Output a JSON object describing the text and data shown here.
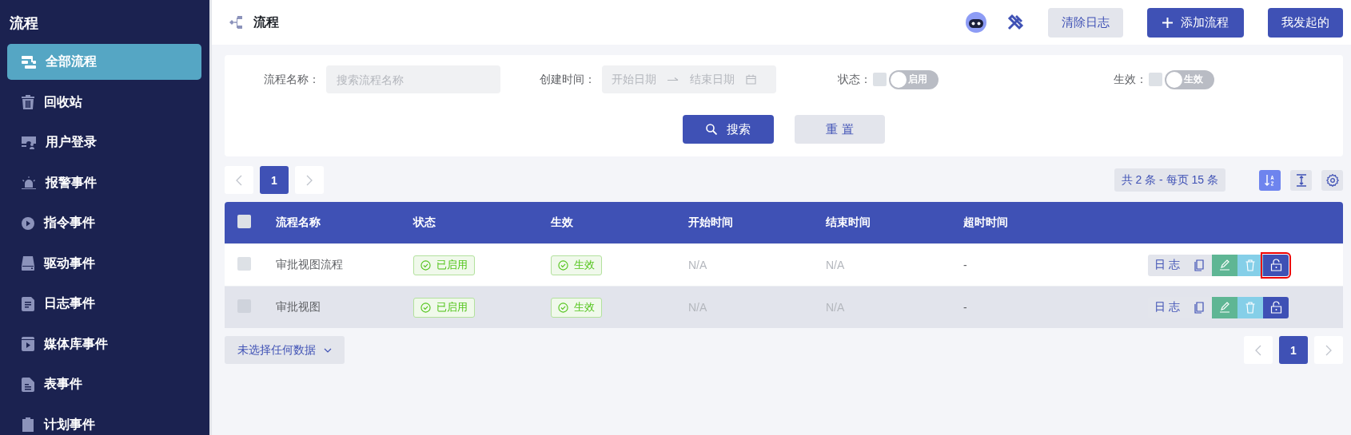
{
  "sidebar": {
    "title": "流程",
    "items": [
      {
        "label": "全部流程",
        "selected": true
      },
      {
        "label": "回收站",
        "selected": false
      },
      {
        "label": "用户登录",
        "selected": false
      },
      {
        "label": "报警事件",
        "selected": false
      },
      {
        "label": "指令事件",
        "selected": false
      },
      {
        "label": "驱动事件",
        "selected": false
      },
      {
        "label": "日志事件",
        "selected": false
      },
      {
        "label": "媒体库事件",
        "selected": false
      },
      {
        "label": "表事件",
        "selected": false
      },
      {
        "label": "计划事件",
        "selected": false
      }
    ]
  },
  "header": {
    "title": "流程",
    "buttons": [
      {
        "label": "清除日志",
        "kind": "secondary"
      },
      {
        "label": "添加流程",
        "kind": "add"
      },
      {
        "label": "我发起的",
        "kind": "primary"
      }
    ]
  },
  "filters": {
    "name": {
      "label": "流程名称：",
      "placeholder": "搜索流程名称"
    },
    "created": {
      "label": "创建时间：",
      "start_placeholder": "开始日期",
      "end_placeholder": "结束日期"
    },
    "switches": [
      {
        "label": "状态：",
        "checked": false,
        "switch_label": "启用",
        "on": false
      },
      {
        "label": "生效：",
        "checked": false,
        "switch_label": "生效",
        "on": false
      }
    ],
    "search_button": "搜索",
    "reset_button": "重 置"
  },
  "top_pager": {
    "pages": [
      {
        "label": "1",
        "selected": true
      }
    ]
  },
  "summary": "共 2 条 - 每页 15 条",
  "toolbar": [
    {
      "kind": "sort",
      "selected": true
    },
    {
      "kind": "height",
      "selected": false
    },
    {
      "kind": "settings",
      "selected": false
    }
  ],
  "table": {
    "all_checked": false,
    "columns": [
      "流程名称",
      "状态",
      "生效",
      "开始时间",
      "结束时间",
      "超时时间"
    ],
    "rows": [
      {
        "checked": false,
        "highlighted": false,
        "name": "审批视图流程",
        "status": "已启用",
        "effective": "生效",
        "start": "N/A",
        "end": "N/A",
        "timeout": "-",
        "log_button": "日 志",
        "unlock_outlined": true
      },
      {
        "checked": false,
        "highlighted": true,
        "name": "审批视图",
        "status": "已启用",
        "effective": "生效",
        "start": "N/A",
        "end": "N/A",
        "timeout": "-",
        "log_button": "日 志",
        "unlock_outlined": false
      }
    ]
  },
  "selection_dropdown": "未选择任何数据",
  "bottom_pager": {
    "pages": [
      {
        "label": "1",
        "selected": true
      }
    ]
  }
}
